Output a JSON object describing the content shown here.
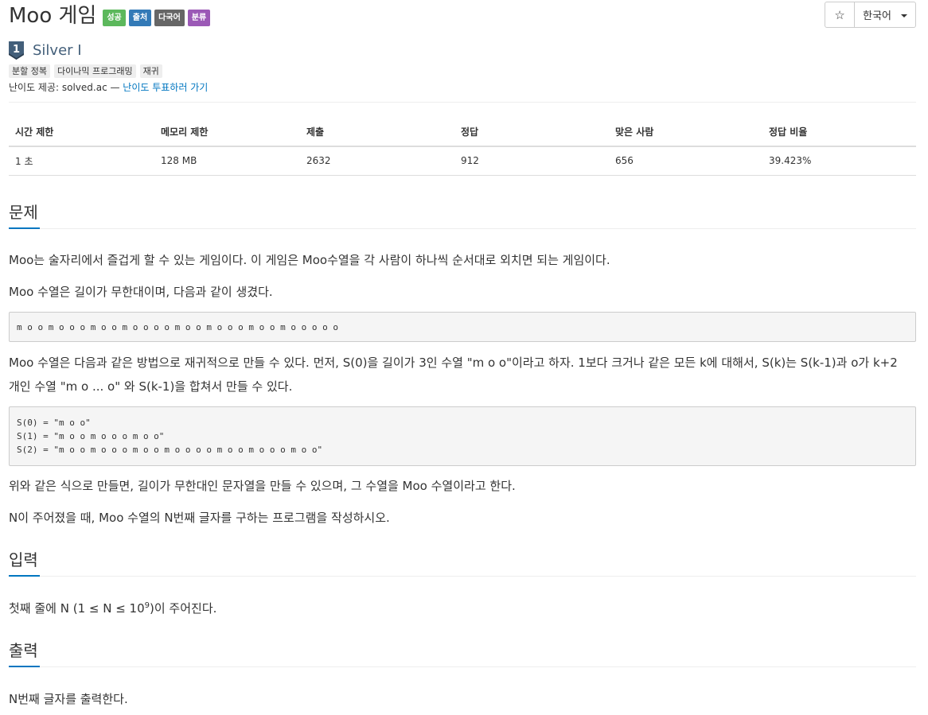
{
  "problem": {
    "title": "Moo 게임",
    "badges": [
      {
        "label": "성공",
        "color": "#5cb85c"
      },
      {
        "label": "출처",
        "color": "#337ab7"
      },
      {
        "label": "다국어",
        "color": "#666666"
      },
      {
        "label": "분류",
        "color": "#9b59b6"
      }
    ],
    "tier": {
      "number": "1",
      "name": "Silver I",
      "color": "#435f7a"
    },
    "tags": [
      "분할 정복",
      "다이나믹 프로그래밍",
      "재귀"
    ],
    "difficulty": {
      "prefix": "난이도 제공: solved.ac — ",
      "vote_link": "난이도 투표하러 가기"
    }
  },
  "actions": {
    "star_glyph": "☆",
    "language": "한국어"
  },
  "info_table": {
    "headers": [
      "시간 제한",
      "메모리 제한",
      "제출",
      "정답",
      "맞은 사람",
      "정답 비율"
    ],
    "values": [
      "1 초",
      "128 MB",
      "2632",
      "912",
      "656",
      "39.423%"
    ]
  },
  "sections": {
    "problem": {
      "heading": "문제",
      "p1": "Moo는 술자리에서 즐겁게 할 수 있는 게임이다. 이 게임은 Moo수열을 각 사람이 하나씩 순서대로 외치면 되는 게임이다.",
      "p2": "Moo 수열은 길이가 무한대이며, 다음과 같이 생겼다.",
      "code1": "m o o m o o o m o o m o o o o m o o m o o o m o o m o o o o o",
      "p3a": "Moo 수열은 다음과 같은 방법으로 재귀적으로 만들 수 있다. 먼저, S(0)을 길이가 3인 수열 \"m o o\"이라고 하자. 1보다 크거나 같은 모든 k에 대해서, S(k)는 S(k-1)과 o가 k+2",
      "p3b": "개인 수열 \"m o ... o\" 와 S(k-1)을 합쳐서 만들 수 있다.",
      "code2": [
        "S(0) = \"m o o\"",
        "S(1) = \"m o o m o o o m o o\"",
        "S(2) = \"m o o m o o o m o o m o o o o m o o m o o o m o o\""
      ],
      "p4": "위와 같은 식으로 만들면, 길이가 무한대인 문자열을 만들 수 있으며, 그 수열을 Moo 수열이라고 한다.",
      "p5": "N이 주어졌을 때, Moo 수열의 N번째 글자를 구하는 프로그램을 작성하시오."
    },
    "input": {
      "heading": "입력",
      "text_before": "첫째 줄에 N (1 ≤ N ≤ 10",
      "sup": "9",
      "text_after": ")이 주어진다."
    },
    "output": {
      "heading": "출력",
      "text": "N번째 글자를 출력한다."
    }
  }
}
